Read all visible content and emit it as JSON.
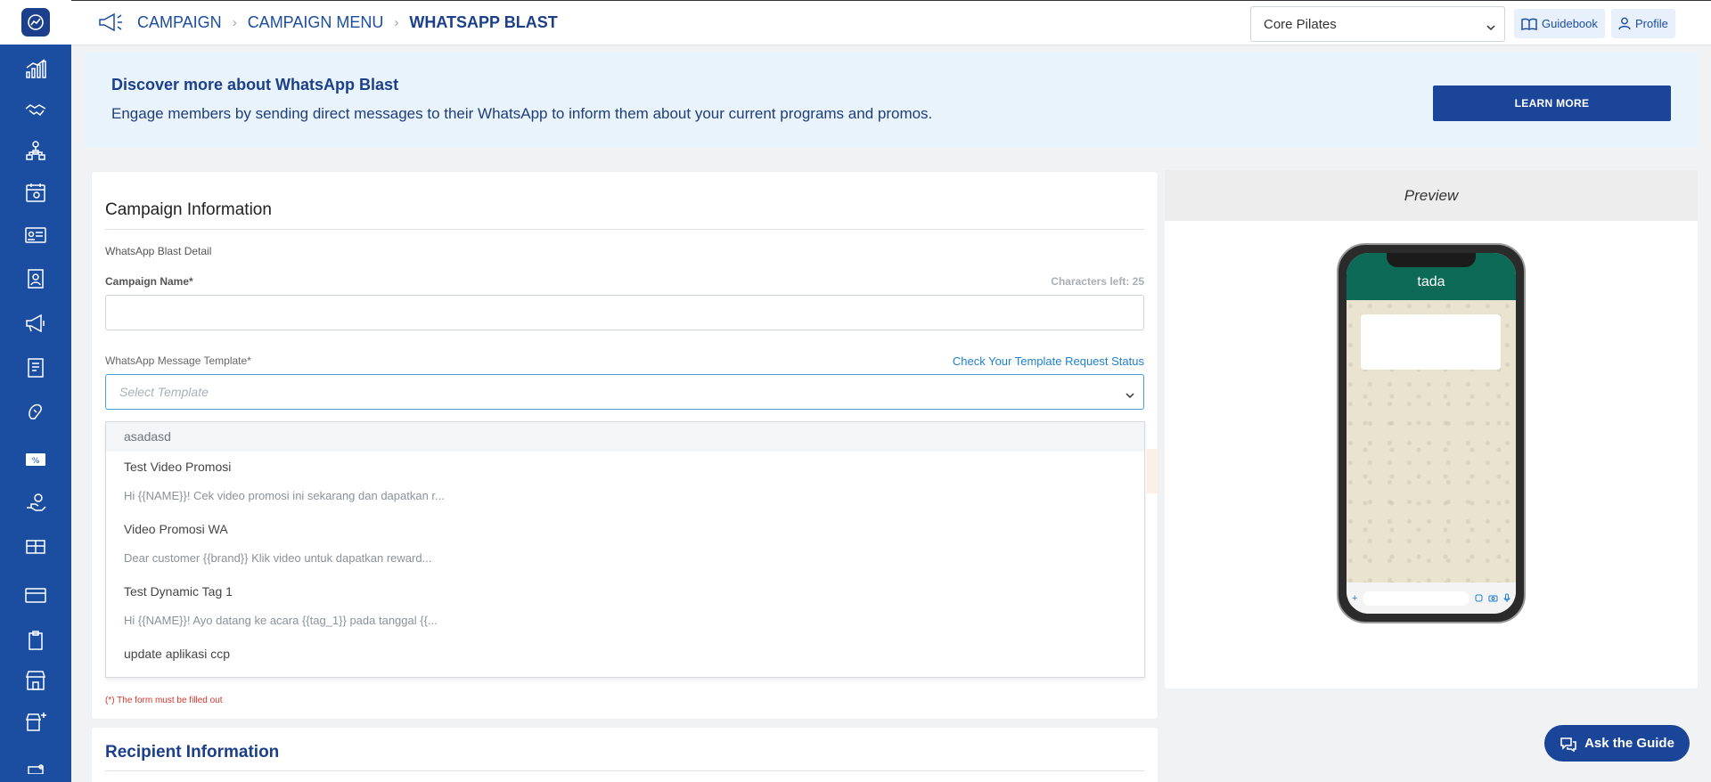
{
  "breadcrumb": {
    "items": [
      "CAMPAIGN",
      "CAMPAIGN MENU"
    ],
    "current": "WHATSAPP BLAST"
  },
  "header": {
    "brand_select": "Core Pilates",
    "guidebook_label": "Guidebook",
    "profile_label": "Profile"
  },
  "banner": {
    "title": "Discover more about WhatsApp Blast",
    "description": "Engage members by sending direct messages to their WhatsApp to inform them about your current programs and promos.",
    "button_label": "LEARN MORE"
  },
  "campaign_info": {
    "title": "Campaign Information",
    "section_label": "WhatsApp Blast Detail",
    "campaign_name_label": "Campaign Name*",
    "characters_left": "Characters left: 25",
    "template_label": "WhatsApp Message Template*",
    "template_status_link": "Check Your Template Request Status",
    "template_placeholder": "Select Template",
    "required_note": "(*) The form must be filled out"
  },
  "template_options": [
    {
      "title": "asadasd",
      "subtitle": ""
    },
    {
      "title": "Test Video Promosi",
      "subtitle": "Hi {{NAME}}! Cek video promosi ini sekarang dan dapatkan r..."
    },
    {
      "title": "Video Promosi WA",
      "subtitle": "Dear customer {{brand}} Klik video untuk dapatkan reward..."
    },
    {
      "title": "Test Dynamic Tag 1",
      "subtitle": "Hi {{NAME}}! Ayo datang ke acara {{tag_1}} pada tanggal {{..."
    },
    {
      "title": "update aplikasi ccp",
      "subtitle": ""
    }
  ],
  "recipient_info": {
    "title": "Recipient Information"
  },
  "preview": {
    "title": "Preview",
    "chat_name": "tada"
  },
  "ask_guide": {
    "label": "Ask the Guide"
  },
  "colors": {
    "sidebar": "#1b4da0",
    "primary_button": "#1b4598",
    "whatsapp_header": "#0c6a56",
    "banner_bg": "#e8f3fc"
  }
}
